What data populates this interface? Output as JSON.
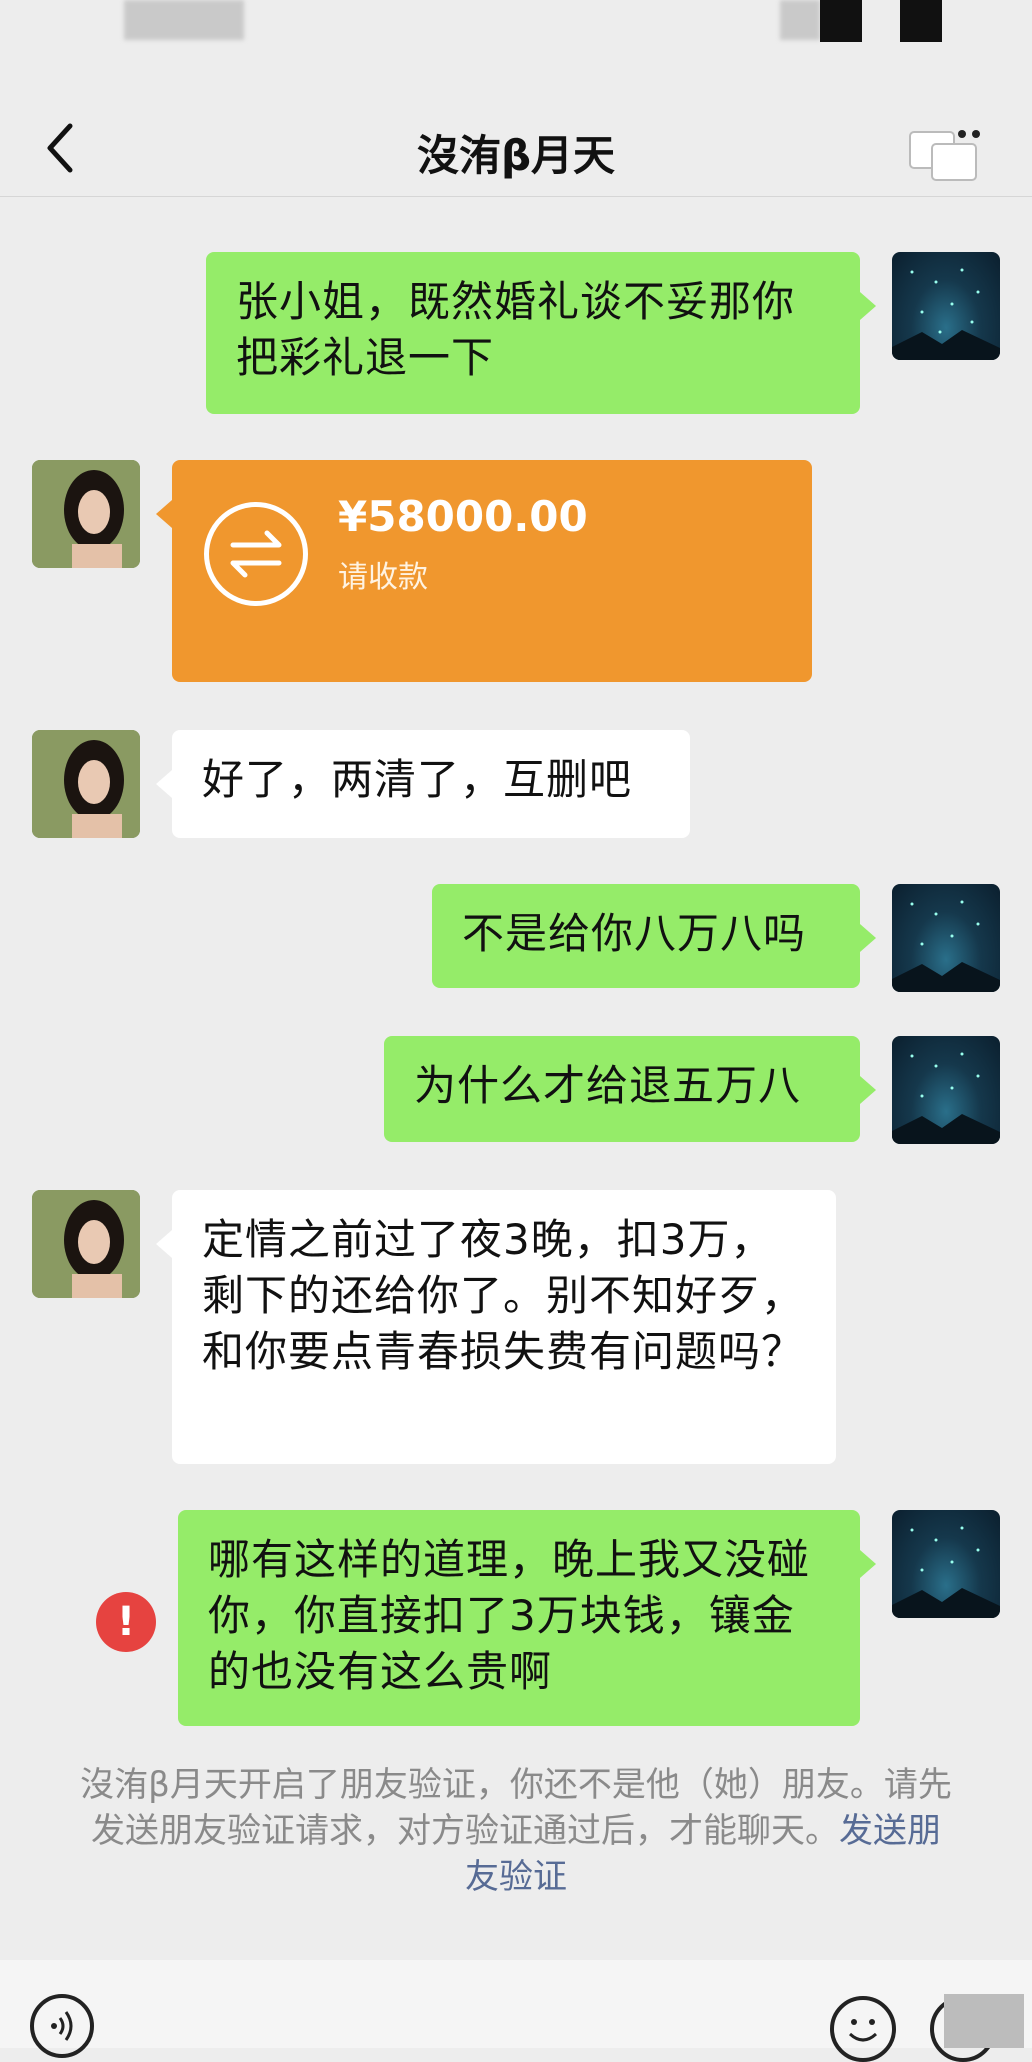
{
  "header": {
    "title": "沒洧β月天"
  },
  "messages": [
    {
      "side": "right",
      "text": "张小姐，既然婚礼谈不妥那你把彩礼退一下"
    },
    {
      "side": "left",
      "type": "transfer",
      "amount": "¥58000.00",
      "note": "请收款"
    },
    {
      "side": "left",
      "text": "好了，两清了，互删吧"
    },
    {
      "side": "right",
      "text": "不是给你八万八吗"
    },
    {
      "side": "right",
      "text": "为什么才给退五万八"
    },
    {
      "side": "left",
      "text": "定情之前过了夜3晚，扣3万，剩下的还给你了。别不知好歹，和你要点青春损失费有问题吗？"
    },
    {
      "side": "right",
      "text": "哪有这样的道理，晚上我又没碰你，你直接扣了3万块钱，镶金的也没有这么贵啊",
      "failed": true
    }
  ],
  "system_notice": {
    "text": "沒洧β月天开启了朋友验证，你还不是他（她）朋友。请先发送朋友验证请求，对方验证通过后，才能聊天。",
    "link": "发送朋友验证"
  },
  "error_mark": "!",
  "colors": {
    "chat_bg": "#ededed",
    "green_bubble": "#95ec69",
    "transfer_orange": "#f0972e",
    "error_red": "#e64340",
    "link_blue": "#576b95"
  },
  "icons": [
    "back-icon",
    "more-icon",
    "transfer-icon",
    "error-icon",
    "voice-icon",
    "emoji-icon",
    "plus-icon"
  ]
}
